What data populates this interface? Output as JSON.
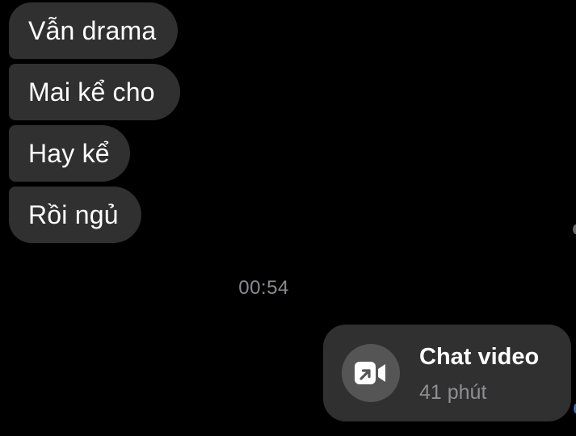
{
  "messages": [
    {
      "text": "Vẫn drama"
    },
    {
      "text": "Mai kể cho"
    },
    {
      "text": "Hay kể"
    },
    {
      "text": "Rồi ngủ"
    }
  ],
  "timestamp": "00:54",
  "call": {
    "title": "Chat video",
    "duration": "41 phút",
    "icon": "video-camera-icon"
  },
  "colors": {
    "background": "#000000",
    "bubble": "#303030",
    "icon_circle": "#555555",
    "secondary_text": "#8e8e93"
  }
}
